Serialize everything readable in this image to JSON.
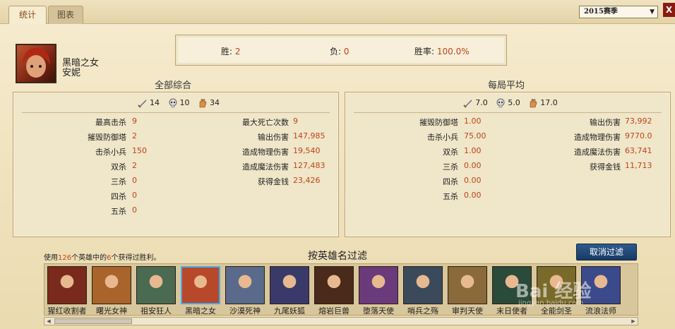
{
  "tabs": [
    {
      "label": "统计",
      "active": true
    },
    {
      "label": "图表",
      "active": false
    }
  ],
  "season": {
    "selected": "2015赛季"
  },
  "close_label": "X",
  "champion": {
    "title": "黑暗之女",
    "name": "安妮"
  },
  "record": {
    "win_label": "胜:",
    "win_value": "2",
    "loss_label": "负:",
    "loss_value": "0",
    "rate_label": "胜率:",
    "rate_value": "100.0%"
  },
  "totals": {
    "title": "全部综合",
    "kills": "14",
    "deaths": "10",
    "assists": "34",
    "left_rows": [
      {
        "label": "最高击杀",
        "value": "9"
      },
      {
        "label": "摧毁防御塔",
        "value": "2"
      },
      {
        "label": "击杀小兵",
        "value": "150"
      },
      {
        "label": "双杀",
        "value": "2"
      },
      {
        "label": "三杀",
        "value": "0"
      },
      {
        "label": "四杀",
        "value": "0"
      },
      {
        "label": "五杀",
        "value": "0"
      }
    ],
    "right_rows": [
      {
        "label": "最大死亡次数",
        "value": "9"
      },
      {
        "label": "输出伤害",
        "value": "147,985"
      },
      {
        "label": "造成物理伤害",
        "value": "19,540"
      },
      {
        "label": "造成魔法伤害",
        "value": "127,483"
      },
      {
        "label": "获得金钱",
        "value": "23,426"
      }
    ]
  },
  "average": {
    "title": "每局平均",
    "kills": "7.0",
    "deaths": "5.0",
    "assists": "17.0",
    "left_rows": [
      {
        "label": "摧毁防御塔",
        "value": "1.00"
      },
      {
        "label": "击杀小兵",
        "value": "75.00"
      },
      {
        "label": "双杀",
        "value": "1.00"
      },
      {
        "label": "三杀",
        "value": "0.00"
      },
      {
        "label": "四杀",
        "value": "0.00"
      },
      {
        "label": "五杀",
        "value": "0.00"
      }
    ],
    "right_rows": [
      {
        "label": "输出伤害",
        "value": "73,992"
      },
      {
        "label": "造成物理伤害",
        "value": "9770.0"
      },
      {
        "label": "造成魔法伤害",
        "value": "63,741"
      },
      {
        "label": "获得金钱",
        "value": "11,713"
      }
    ]
  },
  "filter": {
    "info_prefix": "使用",
    "info_total": "126",
    "info_mid": "个英雄中的",
    "info_wins": "6",
    "info_suffix": "个获得过胜利。",
    "title": "按英雄名过滤",
    "clear_label": "取消过滤"
  },
  "champions": [
    {
      "name": "猩红收割者",
      "color": "#7a2a1c"
    },
    {
      "name": "曙光女神",
      "color": "#a8642a"
    },
    {
      "name": "祖安狂人",
      "color": "#4a6a52"
    },
    {
      "name": "黑暗之女",
      "color": "#b8482a",
      "selected": true
    },
    {
      "name": "沙漠死神",
      "color": "#5a6a8a"
    },
    {
      "name": "九尾妖狐",
      "color": "#3a3a6a"
    },
    {
      "name": "熔岩巨兽",
      "color": "#4a2a1a"
    },
    {
      "name": "堕落天使",
      "color": "#6a3a7a"
    },
    {
      "name": "哨兵之殇",
      "color": "#3a4a5a"
    },
    {
      "name": "审判天使",
      "color": "#8a6a3a"
    },
    {
      "name": "末日使者",
      "color": "#2a4a3a"
    },
    {
      "name": "全能剑圣",
      "color": "#7a6a2a"
    },
    {
      "name": "流浪法师",
      "color": "#3a4a8a"
    }
  ],
  "watermark": {
    "text": "Bai 经验",
    "sub": "jingyan.baidu.com"
  }
}
